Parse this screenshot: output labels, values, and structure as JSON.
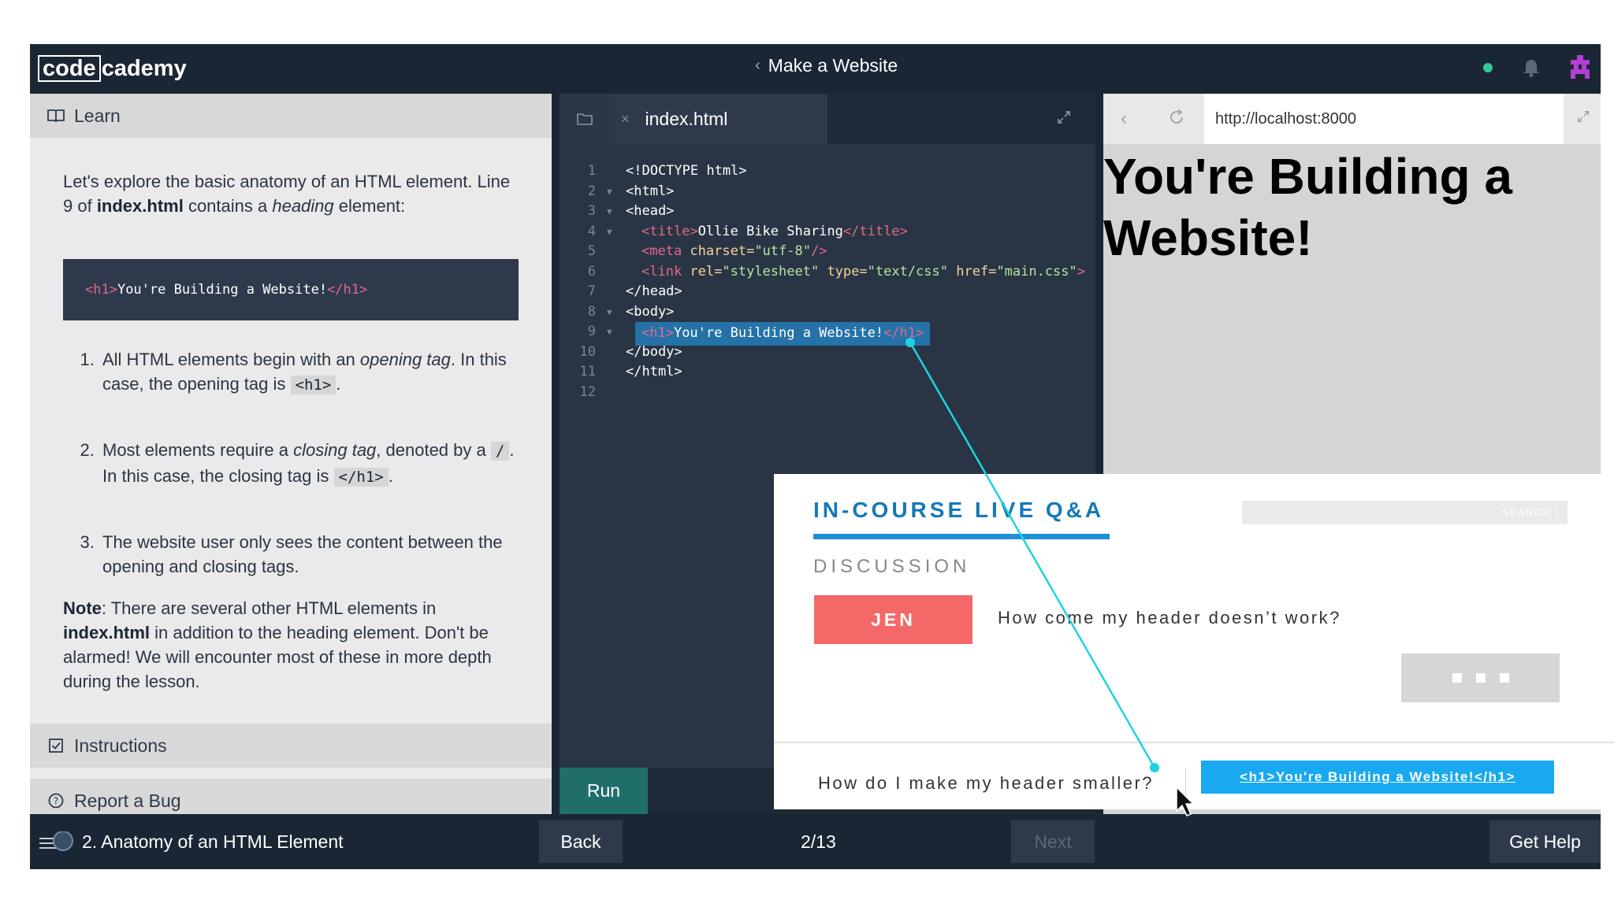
{
  "header": {
    "logo_left": "code",
    "logo_right": "cademy",
    "course_title": "Make a Website",
    "back_chevron": "‹",
    "colors": {
      "brand": "#1b2634",
      "status": "#35c89a",
      "accent": "#b23fd2"
    },
    "icons": [
      "chevron-left-icon",
      "status-dot-icon",
      "bell-icon",
      "avatar-icon"
    ]
  },
  "learn": {
    "label": "Learn",
    "intro_part1": "Let's explore the basic anatomy of an HTML element. Line 9 of ",
    "intro_file": "index.html",
    "intro_part2": " contains a ",
    "intro_em": "heading",
    "intro_part3": " element:",
    "code_open": "<h1>",
    "code_text": "You're Building a Website!",
    "code_close": "</h1>",
    "items": [
      {
        "a": "All HTML elements begin with an ",
        "em": "opening tag",
        "b": ". In this case, the opening tag is ",
        "code": "<h1>",
        "c": "."
      },
      {
        "a": "Most elements require a ",
        "em": "closing tag",
        "b": ", denoted by a ",
        "code": "/",
        "c": ". In this case, the closing tag is ",
        "code2": "</h1>",
        "d": "."
      },
      {
        "a": "The website user only sees the content between the opening and closing tags."
      }
    ],
    "note_label": "Note",
    "note_part1": ": There are several other HTML elements in ",
    "note_file": "index.html",
    "note_part2": " in addition to the heading element. Don't be alarmed! We will encounter most of these in more depth during the lesson.",
    "instructions_label": "Instructions",
    "report_label": "Report a Bug"
  },
  "editor": {
    "tab_close": "×",
    "filename": "index.html",
    "run_label": "Run",
    "line_numbers": [
      "1",
      "2",
      "3",
      "4",
      "5",
      "6",
      "7",
      "8",
      "9",
      "10",
      "11",
      "12"
    ],
    "lines": {
      "l1": "<!DOCTYPE html>",
      "l2": "<html>",
      "l3": "<head>",
      "l4_open": "<title>",
      "l4_text": "Ollie Bike Sharing",
      "l4_close": "</title>",
      "l5_open": "<meta ",
      "l5_attr": "charset=",
      "l5_str": "\"utf-8\"",
      "l5_close": "/>",
      "l6_open": "<link ",
      "l6_attr1": "rel=",
      "l6_str1": "\"stylesheet\"",
      "l6_attr2": " type=",
      "l6_str2": "\"text/css\"",
      "l6_attr3": " href=",
      "l6_str3": "\"main.css\"",
      "l6_close": ">",
      "l7": "</head>",
      "l8": "<body>",
      "l9_open": "<h1>",
      "l9_text": "You're Building a Website!",
      "l9_close": "</h1>",
      "l10": "</body>",
      "l11": "</html>"
    }
  },
  "browser": {
    "back": "‹",
    "url": "http://localhost:8000",
    "preview_heading": "You're Building a Website!"
  },
  "qa": {
    "title": "IN-COURSE LIVE Q&A",
    "search_placeholder": "SEARCH I",
    "discussion_label": "DISCUSSION",
    "user": "JEN",
    "question1": "How come my header doesn’t work?",
    "question2": "How do I make my header smaller?",
    "code_chip": "<h1>You're Building a Website!</h1>",
    "colors": {
      "title": "#1579b8",
      "underline": "#1f8fd8",
      "user_badge": "#f56868",
      "chip": "#19a9f0",
      "connector": "#1ed3e0"
    }
  },
  "footer": {
    "lesson_title": "2. Anatomy of an HTML Element",
    "back_label": "Back",
    "progress": "2/13",
    "next_label": "Next",
    "help_label": "Get Help"
  }
}
